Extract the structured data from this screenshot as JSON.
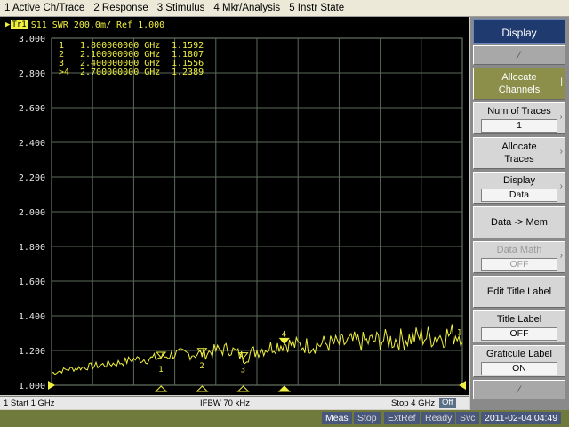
{
  "menu": [
    "1 Active Ch/Trace",
    "2 Response",
    "3 Stimulus",
    "4 Mkr/Analysis",
    "5 Instr State"
  ],
  "trace": {
    "badge": "Tr1",
    "header": "S11  SWR 200.0m/ Ref 1.000"
  },
  "markers_table": [
    {
      "id": " 1",
      "freq": "1.800000000 GHz",
      "value": "1.1592"
    },
    {
      "id": " 2",
      "freq": "2.100000000 GHz",
      "value": "1.1807"
    },
    {
      "id": " 3",
      "freq": "2.400000000 GHz",
      "value": "1.1556"
    },
    {
      "id": ">4",
      "freq": "2.700000000 GHz",
      "value": "1.2389"
    }
  ],
  "chart_data": {
    "type": "line",
    "xlim": [
      1,
      4
    ],
    "ylim": [
      1.0,
      3.0
    ],
    "y_ticks": [
      "3.000",
      "2.800",
      "2.600",
      "2.400",
      "2.200",
      "2.000",
      "1.800",
      "1.600",
      "1.400",
      "1.200",
      "1.000"
    ],
    "grid": true,
    "series": [
      {
        "color": "#f0f040",
        "x": [
          1.0,
          1.1,
          1.2,
          1.3,
          1.4,
          1.5,
          1.6,
          1.7,
          1.8,
          1.9,
          2.0,
          2.1,
          2.2,
          2.3,
          2.4,
          2.5,
          2.6,
          2.7,
          2.8,
          2.9,
          3.0,
          3.1,
          3.2,
          3.3,
          3.4,
          3.5,
          3.6,
          3.7,
          3.8,
          3.9,
          4.0
        ],
        "y": [
          1.07,
          1.09,
          1.1,
          1.11,
          1.12,
          1.13,
          1.15,
          1.15,
          1.16,
          1.18,
          1.18,
          1.18,
          1.2,
          1.21,
          1.16,
          1.2,
          1.22,
          1.24,
          1.23,
          1.23,
          1.24,
          1.24,
          1.25,
          1.25,
          1.26,
          1.26,
          1.27,
          1.28,
          1.28,
          1.29,
          1.3
        ]
      }
    ],
    "markers": [
      {
        "label": "1",
        "x": 1.8,
        "y": 1.1592
      },
      {
        "label": "2",
        "x": 2.1,
        "y": 1.1807
      },
      {
        "label": "3",
        "x": 2.4,
        "y": 1.1556
      },
      {
        "label": "4",
        "x": 2.7,
        "y": 1.2389
      }
    ]
  },
  "status1": {
    "start": "1  Start 1 GHz",
    "ifbw": "IFBW 70 kHz",
    "stop": "Stop 4 GHz",
    "off": "Off"
  },
  "status2": {
    "meas": "Meas",
    "stop": "Stop",
    "extref": "ExtRef",
    "ready": "Ready",
    "svc": "Svc",
    "datetime": "2011-02-04 04:49"
  },
  "softkeys": {
    "title": "Display",
    "allocate_channels": "Allocate\nChannels",
    "num_traces": {
      "label": "Num of Traces",
      "value": "1"
    },
    "allocate_traces": "Allocate\nTraces",
    "display": {
      "label": "Display",
      "value": "Data"
    },
    "data_mem": "Data -> Mem",
    "data_math": {
      "label": "Data Math",
      "value": "OFF"
    },
    "edit_title": "Edit Title Label",
    "title_label": {
      "label": "Title Label",
      "value": "OFF"
    },
    "graticule_label": {
      "label": "Graticule Label",
      "value": "ON"
    }
  },
  "colors": {
    "trace": "#f0f040",
    "grid": "#5a6a5a",
    "screen_bg": "#000000"
  }
}
